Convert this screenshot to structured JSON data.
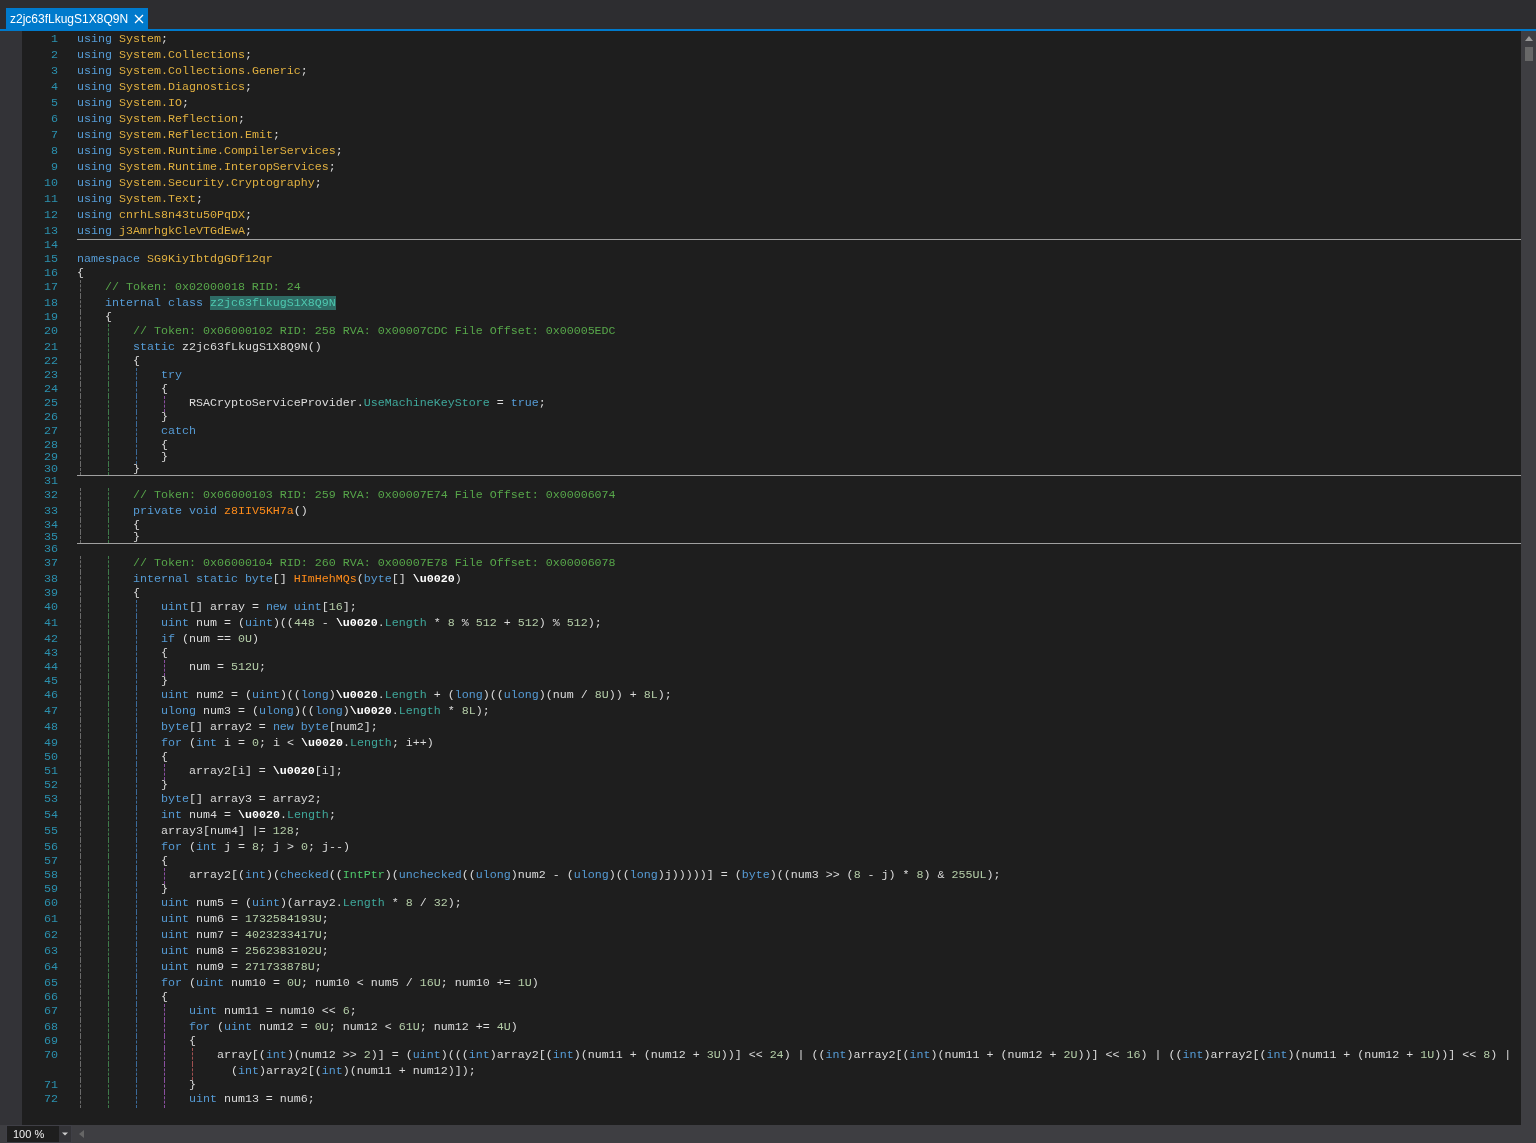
{
  "tabs": [
    {
      "label": "z2jc63fLkugS1X8Q9N",
      "selected": true
    }
  ],
  "editor": {
    "lines": [
      {
        "number": "1",
        "separator_after": false,
        "segments": [
          {
            "kind": "keyword",
            "text": "using "
          },
          {
            "kind": "namespace",
            "text": "System"
          },
          {
            "kind": "plain",
            "text": ";"
          }
        ]
      },
      {
        "number": "2",
        "separator_after": false,
        "segments": [
          {
            "kind": "keyword",
            "text": "using "
          },
          {
            "kind": "namespace",
            "text": "System.Collections"
          },
          {
            "kind": "plain",
            "text": ";"
          }
        ]
      },
      {
        "number": "3",
        "separator_after": false,
        "segments": [
          {
            "kind": "keyword",
            "text": "using "
          },
          {
            "kind": "namespace",
            "text": "System.Collections.Generic"
          },
          {
            "kind": "plain",
            "text": ";"
          }
        ]
      },
      {
        "number": "4",
        "separator_after": false,
        "segments": [
          {
            "kind": "keyword",
            "text": "using "
          },
          {
            "kind": "namespace",
            "text": "System.Diagnostics"
          },
          {
            "kind": "plain",
            "text": ";"
          }
        ]
      },
      {
        "number": "5",
        "separator_after": false,
        "segments": [
          {
            "kind": "keyword",
            "text": "using "
          },
          {
            "kind": "namespace",
            "text": "System.IO"
          },
          {
            "kind": "plain",
            "text": ";"
          }
        ]
      },
      {
        "number": "6",
        "separator_after": false,
        "segments": [
          {
            "kind": "keyword",
            "text": "using "
          },
          {
            "kind": "namespace",
            "text": "System.Reflection"
          },
          {
            "kind": "plain",
            "text": ";"
          }
        ]
      },
      {
        "number": "7",
        "separator_after": false,
        "segments": [
          {
            "kind": "keyword",
            "text": "using "
          },
          {
            "kind": "namespace",
            "text": "System.Reflection.Emit"
          },
          {
            "kind": "plain",
            "text": ";"
          }
        ]
      },
      {
        "number": "8",
        "separator_after": false,
        "segments": [
          {
            "kind": "keyword",
            "text": "using "
          },
          {
            "kind": "namespace",
            "text": "System.Runtime.CompilerServices"
          },
          {
            "kind": "plain",
            "text": ";"
          }
        ]
      },
      {
        "number": "9",
        "separator_after": false,
        "segments": [
          {
            "kind": "keyword",
            "text": "using "
          },
          {
            "kind": "namespace",
            "text": "System.Runtime.InteropServices"
          },
          {
            "kind": "plain",
            "text": ";"
          }
        ]
      },
      {
        "number": "10",
        "separator_after": false,
        "segments": [
          {
            "kind": "keyword",
            "text": "using "
          },
          {
            "kind": "namespace",
            "text": "System.Security.Cryptography"
          },
          {
            "kind": "plain",
            "text": ";"
          }
        ]
      },
      {
        "number": "11",
        "separator_after": false,
        "segments": [
          {
            "kind": "keyword",
            "text": "using "
          },
          {
            "kind": "namespace",
            "text": "System.Text"
          },
          {
            "kind": "plain",
            "text": ";"
          }
        ]
      },
      {
        "number": "12",
        "separator_after": false,
        "segments": [
          {
            "kind": "keyword",
            "text": "using "
          },
          {
            "kind": "namespace",
            "text": "cnrhLs8n43tu50PqDX"
          },
          {
            "kind": "plain",
            "text": ";"
          }
        ]
      },
      {
        "number": "13",
        "separator_after": true,
        "segments": [
          {
            "kind": "keyword",
            "text": "using "
          },
          {
            "kind": "namespace",
            "text": "j3AmrhgkCleVTGdEwA"
          },
          {
            "kind": "plain",
            "text": ";"
          }
        ]
      },
      {
        "number": "14",
        "separator_after": false
      },
      {
        "number": "15",
        "separator_after": false,
        "segments": [
          {
            "kind": "keyword",
            "text": "namespace "
          },
          {
            "kind": "namespace",
            "text": "SG9KiyIbtdgGDf12qr"
          }
        ]
      },
      {
        "number": "16",
        "separator_after": false,
        "segments": [
          {
            "kind": "plain",
            "text": "{"
          }
        ]
      },
      {
        "number": "17",
        "separator_after": false,
        "segments": [
          {
            "kind": "comment",
            "text": "    // Token: 0x02000018 RID: 24"
          }
        ]
      },
      {
        "number": "18",
        "separator_after": false,
        "segments": [
          {
            "kind": "keyword",
            "text": "    internal class "
          },
          {
            "kind": "highlight",
            "text": "z2jc63fLkugS1X8Q9N"
          }
        ]
      },
      {
        "number": "19",
        "separator_after": false,
        "segments": [
          {
            "kind": "plain",
            "text": "    {"
          }
        ]
      },
      {
        "number": "20",
        "separator_after": false,
        "segments": [
          {
            "kind": "comment",
            "text": "        // Token: 0x06000102 RID: 258 RVA: 0x00007CDC File Offset: 0x00005EDC"
          }
        ]
      },
      {
        "number": "21",
        "separator_after": false,
        "segments": [
          {
            "kind": "keyword",
            "text": "        static"
          },
          {
            "kind": "plain",
            "text": " z2jc63fLkugS1X8Q9N()"
          }
        ]
      },
      {
        "number": "22",
        "separator_after": false,
        "segments": [
          {
            "kind": "plain",
            "text": "        {"
          }
        ]
      },
      {
        "number": "23",
        "separator_after": false,
        "segments": [
          {
            "kind": "keyword",
            "text": "            try"
          }
        ]
      },
      {
        "number": "24",
        "separator_after": false,
        "segments": [
          {
            "kind": "plain",
            "text": "            {"
          }
        ]
      },
      {
        "number": "25",
        "separator_after": false,
        "segments": [
          {
            "kind": "plain",
            "text": "                RSACryptoServiceProvider."
          },
          {
            "kind": "member",
            "text": "UseMachineKeyStore"
          },
          {
            "kind": "plain",
            "text": " = "
          },
          {
            "kind": "keyword",
            "text": "true"
          },
          {
            "kind": "plain",
            "text": ";"
          }
        ]
      },
      {
        "number": "26",
        "separator_after": false,
        "segments": [
          {
            "kind": "plain",
            "text": "            }"
          }
        ]
      },
      {
        "number": "27",
        "separator_after": false,
        "segments": [
          {
            "kind": "keyword",
            "text": "            catch"
          }
        ]
      },
      {
        "number": "28",
        "separator_after": false,
        "segments": [
          {
            "kind": "plain",
            "text": "            {"
          }
        ]
      },
      {
        "number": "29",
        "separator_after": false,
        "segments": [
          {
            "kind": "plain",
            "text": "            }"
          }
        ]
      },
      {
        "number": "30",
        "separator_after": true,
        "segments": [
          {
            "kind": "plain",
            "text": "        }"
          }
        ]
      },
      {
        "number": "31",
        "separator_after": false
      },
      {
        "number": "32",
        "separator_after": false,
        "segments": [
          {
            "kind": "comment",
            "text": "        // Token: 0x06000103 RID: 259 RVA: 0x00007E74 File Offset: 0x00006074"
          }
        ]
      },
      {
        "number": "33",
        "separator_after": false,
        "segments": [
          {
            "kind": "keyword",
            "text": "        private void "
          },
          {
            "kind": "method",
            "text": "z8IIV5KH7a"
          },
          {
            "kind": "plain",
            "text": "()"
          }
        ]
      },
      {
        "number": "34",
        "separator_after": false,
        "segments": [
          {
            "kind": "plain",
            "text": "        {"
          }
        ]
      },
      {
        "number": "35",
        "separator_after": true,
        "segments": [
          {
            "kind": "plain",
            "text": "        }"
          }
        ]
      },
      {
        "number": "36",
        "separator_after": false
      },
      {
        "number": "37",
        "separator_after": false,
        "segments": [
          {
            "kind": "comment",
            "text": "        // Token: 0x06000104 RID: 260 RVA: 0x00007E78 File Offset: 0x00006078"
          }
        ]
      },
      {
        "number": "38",
        "separator_after": false,
        "segments": [
          {
            "kind": "keyword",
            "text": "        internal static byte"
          },
          {
            "kind": "plain",
            "text": "[] "
          },
          {
            "kind": "method",
            "text": "HImHehMQs"
          },
          {
            "kind": "plain",
            "text": "("
          },
          {
            "kind": "keyword",
            "text": "byte"
          },
          {
            "kind": "plain",
            "text": "[] "
          },
          {
            "kind": "param",
            "text": "\\u0020"
          },
          {
            "kind": "plain",
            "text": ")"
          }
        ]
      },
      {
        "number": "39",
        "separator_after": false,
        "segments": [
          {
            "kind": "plain",
            "text": "        {"
          }
        ]
      },
      {
        "number": "40",
        "separator_after": false,
        "segments": [
          {
            "kind": "keyword",
            "text": "            uint"
          },
          {
            "kind": "plain",
            "text": "[] array = "
          },
          {
            "kind": "keyword",
            "text": "new uint"
          },
          {
            "kind": "plain",
            "text": "["
          },
          {
            "kind": "number",
            "text": "16"
          },
          {
            "kind": "plain",
            "text": "];"
          }
        ]
      },
      {
        "number": "41",
        "separator_after": false,
        "segments": [
          {
            "kind": "keyword",
            "text": "            uint"
          },
          {
            "kind": "plain",
            "text": " num = ("
          },
          {
            "kind": "keyword",
            "text": "uint"
          },
          {
            "kind": "plain",
            "text": ")(("
          },
          {
            "kind": "number",
            "text": "448"
          },
          {
            "kind": "plain",
            "text": " - "
          },
          {
            "kind": "param",
            "text": "\\u0020"
          },
          {
            "kind": "plain",
            "text": "."
          },
          {
            "kind": "member",
            "text": "Length"
          },
          {
            "kind": "plain",
            "text": " * "
          },
          {
            "kind": "number",
            "text": "8"
          },
          {
            "kind": "plain",
            "text": " % "
          },
          {
            "kind": "number",
            "text": "512"
          },
          {
            "kind": "plain",
            "text": " + "
          },
          {
            "kind": "number",
            "text": "512"
          },
          {
            "kind": "plain",
            "text": ") % "
          },
          {
            "kind": "number",
            "text": "512"
          },
          {
            "kind": "plain",
            "text": ");"
          }
        ]
      },
      {
        "number": "42",
        "separator_after": false,
        "segments": [
          {
            "kind": "keyword",
            "text": "            if"
          },
          {
            "kind": "plain",
            "text": " (num == "
          },
          {
            "kind": "number",
            "text": "0U"
          },
          {
            "kind": "plain",
            "text": ")"
          }
        ]
      },
      {
        "number": "43",
        "separator_after": false,
        "segments": [
          {
            "kind": "plain",
            "text": "            {"
          }
        ]
      },
      {
        "number": "44",
        "separator_after": false,
        "segments": [
          {
            "kind": "plain",
            "text": "                num = "
          },
          {
            "kind": "number",
            "text": "512U"
          },
          {
            "kind": "plain",
            "text": ";"
          }
        ]
      },
      {
        "number": "45",
        "separator_after": false,
        "segments": [
          {
            "kind": "plain",
            "text": "            }"
          }
        ]
      },
      {
        "number": "46",
        "separator_after": false,
        "segments": [
          {
            "kind": "keyword",
            "text": "            uint"
          },
          {
            "kind": "plain",
            "text": " num2 = ("
          },
          {
            "kind": "keyword",
            "text": "uint"
          },
          {
            "kind": "plain",
            "text": ")(("
          },
          {
            "kind": "keyword",
            "text": "long"
          },
          {
            "kind": "plain",
            "text": ")"
          },
          {
            "kind": "param",
            "text": "\\u0020"
          },
          {
            "kind": "plain",
            "text": "."
          },
          {
            "kind": "member",
            "text": "Length"
          },
          {
            "kind": "plain",
            "text": " + ("
          },
          {
            "kind": "keyword",
            "text": "long"
          },
          {
            "kind": "plain",
            "text": ")(("
          },
          {
            "kind": "keyword",
            "text": "ulong"
          },
          {
            "kind": "plain",
            "text": ")(num / "
          },
          {
            "kind": "number",
            "text": "8U"
          },
          {
            "kind": "plain",
            "text": ")) + "
          },
          {
            "kind": "number",
            "text": "8L"
          },
          {
            "kind": "plain",
            "text": ");"
          }
        ]
      },
      {
        "number": "47",
        "separator_after": false,
        "segments": [
          {
            "kind": "keyword",
            "text": "            ulong"
          },
          {
            "kind": "plain",
            "text": " num3 = ("
          },
          {
            "kind": "keyword",
            "text": "ulong"
          },
          {
            "kind": "plain",
            "text": ")(("
          },
          {
            "kind": "keyword",
            "text": "long"
          },
          {
            "kind": "plain",
            "text": ")"
          },
          {
            "kind": "param",
            "text": "\\u0020"
          },
          {
            "kind": "plain",
            "text": "."
          },
          {
            "kind": "member",
            "text": "Length"
          },
          {
            "kind": "plain",
            "text": " * "
          },
          {
            "kind": "number",
            "text": "8L"
          },
          {
            "kind": "plain",
            "text": ");"
          }
        ]
      },
      {
        "number": "48",
        "separator_after": false,
        "segments": [
          {
            "kind": "keyword",
            "text": "            byte"
          },
          {
            "kind": "plain",
            "text": "[] array2 = "
          },
          {
            "kind": "keyword",
            "text": "new byte"
          },
          {
            "kind": "plain",
            "text": "[num2];"
          }
        ]
      },
      {
        "number": "49",
        "separator_after": false,
        "segments": [
          {
            "kind": "keyword",
            "text": "            for"
          },
          {
            "kind": "plain",
            "text": " ("
          },
          {
            "kind": "keyword",
            "text": "int"
          },
          {
            "kind": "plain",
            "text": " i = "
          },
          {
            "kind": "number",
            "text": "0"
          },
          {
            "kind": "plain",
            "text": "; i < "
          },
          {
            "kind": "param",
            "text": "\\u0020"
          },
          {
            "kind": "plain",
            "text": "."
          },
          {
            "kind": "member",
            "text": "Length"
          },
          {
            "kind": "plain",
            "text": "; i++)"
          }
        ]
      },
      {
        "number": "50",
        "separator_after": false,
        "segments": [
          {
            "kind": "plain",
            "text": "            {"
          }
        ]
      },
      {
        "number": "51",
        "separator_after": false,
        "segments": [
          {
            "kind": "plain",
            "text": "                array2[i] = "
          },
          {
            "kind": "param",
            "text": "\\u0020"
          },
          {
            "kind": "plain",
            "text": "[i];"
          }
        ]
      },
      {
        "number": "52",
        "separator_after": false,
        "segments": [
          {
            "kind": "plain",
            "text": "            }"
          }
        ]
      },
      {
        "number": "53",
        "separator_after": false,
        "segments": [
          {
            "kind": "keyword",
            "text": "            byte"
          },
          {
            "kind": "plain",
            "text": "[] array3 = array2;"
          }
        ]
      },
      {
        "number": "54",
        "separator_after": false,
        "segments": [
          {
            "kind": "keyword",
            "text": "            int"
          },
          {
            "kind": "plain",
            "text": " num4 = "
          },
          {
            "kind": "param",
            "text": "\\u0020"
          },
          {
            "kind": "plain",
            "text": "."
          },
          {
            "kind": "member",
            "text": "Length"
          },
          {
            "kind": "plain",
            "text": ";"
          }
        ]
      },
      {
        "number": "55",
        "separator_after": false,
        "segments": [
          {
            "kind": "plain",
            "text": "            array3[num4] |= "
          },
          {
            "kind": "number",
            "text": "128"
          },
          {
            "kind": "plain",
            "text": ";"
          }
        ]
      },
      {
        "number": "56",
        "separator_after": false,
        "segments": [
          {
            "kind": "keyword",
            "text": "            for"
          },
          {
            "kind": "plain",
            "text": " ("
          },
          {
            "kind": "keyword",
            "text": "int"
          },
          {
            "kind": "plain",
            "text": " j = "
          },
          {
            "kind": "number",
            "text": "8"
          },
          {
            "kind": "plain",
            "text": "; j > "
          },
          {
            "kind": "number",
            "text": "0"
          },
          {
            "kind": "plain",
            "text": "; j--)"
          }
        ]
      },
      {
        "number": "57",
        "separator_after": false,
        "segments": [
          {
            "kind": "plain",
            "text": "            {"
          }
        ]
      },
      {
        "number": "58",
        "separator_after": false,
        "segments": [
          {
            "kind": "plain",
            "text": "                array2[("
          },
          {
            "kind": "keyword",
            "text": "int"
          },
          {
            "kind": "plain",
            "text": ")("
          },
          {
            "kind": "keyword",
            "text": "checked"
          },
          {
            "kind": "plain",
            "text": "(("
          },
          {
            "kind": "type",
            "text": "IntPtr"
          },
          {
            "kind": "plain",
            "text": ")("
          },
          {
            "kind": "keyword",
            "text": "unchecked"
          },
          {
            "kind": "plain",
            "text": "(("
          },
          {
            "kind": "keyword",
            "text": "ulong"
          },
          {
            "kind": "plain",
            "text": ")num2 - ("
          },
          {
            "kind": "keyword",
            "text": "ulong"
          },
          {
            "kind": "plain",
            "text": ")(("
          },
          {
            "kind": "keyword",
            "text": "long"
          },
          {
            "kind": "plain",
            "text": ")j)))))] = ("
          },
          {
            "kind": "keyword",
            "text": "byte"
          },
          {
            "kind": "plain",
            "text": ")((num3 >> ("
          },
          {
            "kind": "number",
            "text": "8"
          },
          {
            "kind": "plain",
            "text": " - j) * "
          },
          {
            "kind": "number",
            "text": "8"
          },
          {
            "kind": "plain",
            "text": ") & "
          },
          {
            "kind": "number",
            "text": "255UL"
          },
          {
            "kind": "plain",
            "text": ");"
          }
        ]
      },
      {
        "number": "59",
        "separator_after": false,
        "segments": [
          {
            "kind": "plain",
            "text": "            }"
          }
        ]
      },
      {
        "number": "60",
        "separator_after": false,
        "segments": [
          {
            "kind": "keyword",
            "text": "            uint"
          },
          {
            "kind": "plain",
            "text": " num5 = ("
          },
          {
            "kind": "keyword",
            "text": "uint"
          },
          {
            "kind": "plain",
            "text": ")(array2."
          },
          {
            "kind": "member",
            "text": "Length"
          },
          {
            "kind": "plain",
            "text": " * "
          },
          {
            "kind": "number",
            "text": "8"
          },
          {
            "kind": "plain",
            "text": " / "
          },
          {
            "kind": "number",
            "text": "32"
          },
          {
            "kind": "plain",
            "text": ");"
          }
        ]
      },
      {
        "number": "61",
        "separator_after": false,
        "segments": [
          {
            "kind": "keyword",
            "text": "            uint"
          },
          {
            "kind": "plain",
            "text": " num6 = "
          },
          {
            "kind": "number",
            "text": "1732584193U"
          },
          {
            "kind": "plain",
            "text": ";"
          }
        ]
      },
      {
        "number": "62",
        "separator_after": false,
        "segments": [
          {
            "kind": "keyword",
            "text": "            uint"
          },
          {
            "kind": "plain",
            "text": " num7 = "
          },
          {
            "kind": "number",
            "text": "4023233417U"
          },
          {
            "kind": "plain",
            "text": ";"
          }
        ]
      },
      {
        "number": "63",
        "separator_after": false,
        "segments": [
          {
            "kind": "keyword",
            "text": "            uint"
          },
          {
            "kind": "plain",
            "text": " num8 = "
          },
          {
            "kind": "number",
            "text": "2562383102U"
          },
          {
            "kind": "plain",
            "text": ";"
          }
        ]
      },
      {
        "number": "64",
        "separator_after": false,
        "segments": [
          {
            "kind": "keyword",
            "text": "            uint"
          },
          {
            "kind": "plain",
            "text": " num9 = "
          },
          {
            "kind": "number",
            "text": "271733878U"
          },
          {
            "kind": "plain",
            "text": ";"
          }
        ]
      },
      {
        "number": "65",
        "separator_after": false,
        "segments": [
          {
            "kind": "keyword",
            "text": "            for"
          },
          {
            "kind": "plain",
            "text": " ("
          },
          {
            "kind": "keyword",
            "text": "uint"
          },
          {
            "kind": "plain",
            "text": " num10 = "
          },
          {
            "kind": "number",
            "text": "0U"
          },
          {
            "kind": "plain",
            "text": "; num10 < num5 / "
          },
          {
            "kind": "number",
            "text": "16U"
          },
          {
            "kind": "plain",
            "text": "; num10 += "
          },
          {
            "kind": "number",
            "text": "1U"
          },
          {
            "kind": "plain",
            "text": ")"
          }
        ]
      },
      {
        "number": "66",
        "separator_after": false,
        "segments": [
          {
            "kind": "plain",
            "text": "            {"
          }
        ]
      },
      {
        "number": "67",
        "separator_after": false,
        "segments": [
          {
            "kind": "keyword",
            "text": "                uint"
          },
          {
            "kind": "plain",
            "text": " num11 = num10 << "
          },
          {
            "kind": "number",
            "text": "6"
          },
          {
            "kind": "plain",
            "text": ";"
          }
        ]
      },
      {
        "number": "68",
        "separator_after": false,
        "segments": [
          {
            "kind": "keyword",
            "text": "                for"
          },
          {
            "kind": "plain",
            "text": " ("
          },
          {
            "kind": "keyword",
            "text": "uint"
          },
          {
            "kind": "plain",
            "text": " num12 = "
          },
          {
            "kind": "number",
            "text": "0U"
          },
          {
            "kind": "plain",
            "text": "; num12 < "
          },
          {
            "kind": "number",
            "text": "61U"
          },
          {
            "kind": "plain",
            "text": "; num12 += "
          },
          {
            "kind": "number",
            "text": "4U"
          },
          {
            "kind": "plain",
            "text": ")"
          }
        ]
      },
      {
        "number": "69",
        "separator_after": false,
        "segments": [
          {
            "kind": "plain",
            "text": "                {"
          }
        ]
      },
      {
        "number": "70",
        "separator_after": false,
        "segments": [
          {
            "kind": "plain",
            "text": "                    array[("
          },
          {
            "kind": "keyword",
            "text": "int"
          },
          {
            "kind": "plain",
            "text": ")(num12 >> "
          },
          {
            "kind": "number",
            "text": "2"
          },
          {
            "kind": "plain",
            "text": ")] = ("
          },
          {
            "kind": "keyword",
            "text": "uint"
          },
          {
            "kind": "plain",
            "text": ")((("
          },
          {
            "kind": "keyword",
            "text": "int"
          },
          {
            "kind": "plain",
            "text": ")array2[("
          },
          {
            "kind": "keyword",
            "text": "int"
          },
          {
            "kind": "plain",
            "text": ")(num11 + (num12 + "
          },
          {
            "kind": "number",
            "text": "3U"
          },
          {
            "kind": "plain",
            "text": "))] << "
          },
          {
            "kind": "number",
            "text": "24"
          },
          {
            "kind": "plain",
            "text": ") | (("
          },
          {
            "kind": "keyword",
            "text": "int"
          },
          {
            "kind": "plain",
            "text": ")array2[("
          },
          {
            "kind": "keyword",
            "text": "int"
          },
          {
            "kind": "plain",
            "text": ")(num11 + (num12 + "
          },
          {
            "kind": "number",
            "text": "2U"
          },
          {
            "kind": "plain",
            "text": "))] << "
          },
          {
            "kind": "number",
            "text": "16"
          },
          {
            "kind": "plain",
            "text": ") | (("
          },
          {
            "kind": "keyword",
            "text": "int"
          },
          {
            "kind": "plain",
            "text": ")array2[("
          },
          {
            "kind": "keyword",
            "text": "int"
          },
          {
            "kind": "plain",
            "text": ")(num11 + (num12 + "
          },
          {
            "kind": "number",
            "text": "1U"
          },
          {
            "kind": "plain",
            "text": "))] << "
          },
          {
            "kind": "number",
            "text": "8"
          },
          {
            "kind": "plain",
            "text": ") |"
          }
        ],
        "wrap_segments": [
          {
            "kind": "plain",
            "text": "                      ("
          },
          {
            "kind": "keyword",
            "text": "int"
          },
          {
            "kind": "plain",
            "text": ")array2[("
          },
          {
            "kind": "keyword",
            "text": "int"
          },
          {
            "kind": "plain",
            "text": ")(num11 + num12)]);"
          }
        ]
      },
      {
        "number": "71",
        "separator_after": false,
        "segments": [
          {
            "kind": "plain",
            "text": "                }"
          }
        ]
      },
      {
        "number": "72",
        "separator_after": false,
        "segments": [
          {
            "kind": "keyword",
            "text": "                uint"
          },
          {
            "kind": "plain",
            "text": " num13 = num6;"
          }
        ]
      }
    ]
  },
  "status_bar": {
    "zoom": "100 %"
  }
}
